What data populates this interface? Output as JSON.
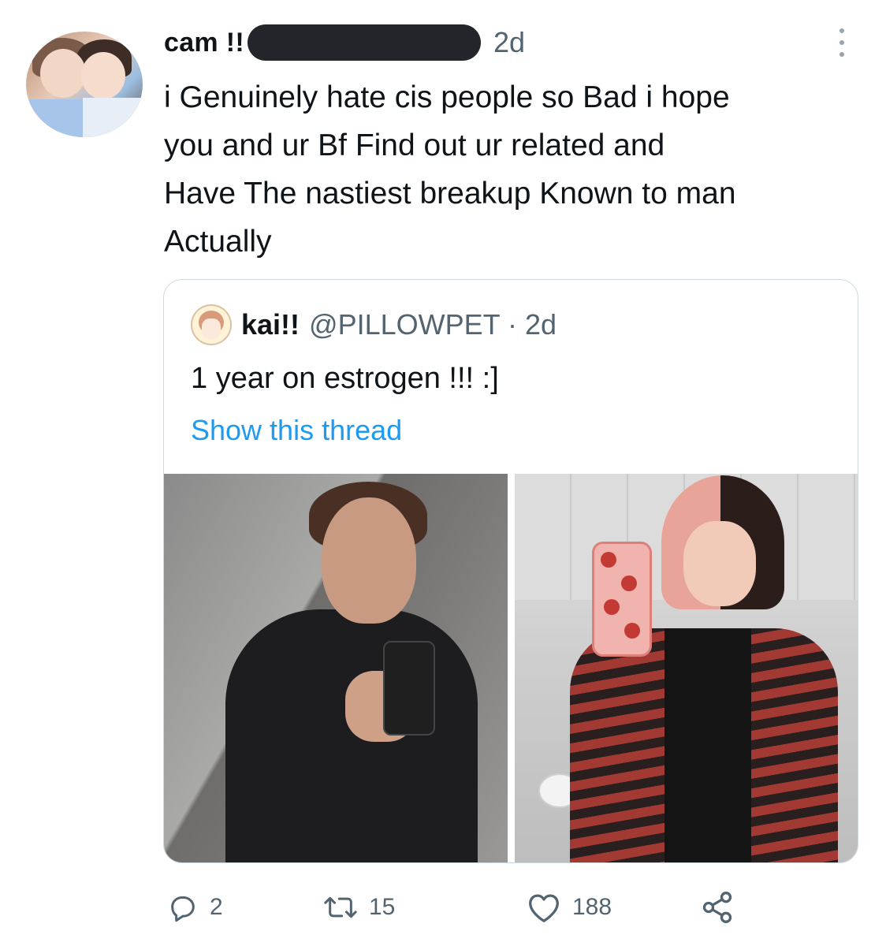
{
  "tweet": {
    "author_name": "cam !!",
    "time": "2d",
    "text": "i Genuinely hate cis people so Bad i hope\nyou and ur Bf Find out ur related and\nHave The nastiest breakup Known to man\nActually",
    "actions": {
      "replies": "2",
      "retweets": "15",
      "likes": "188"
    }
  },
  "quoted": {
    "author_name": "kai!!",
    "handle_time": "@PILLOWPET · 2d",
    "text": "1 year on estrogen !!! :]",
    "show_thread": "Show this thread"
  },
  "colors": {
    "secondary_text": "#536471",
    "link": "#1d9bf0",
    "border": "#cfd9de",
    "censor_bar": "#24252b"
  },
  "icons": [
    "more-icon",
    "reply-icon",
    "retweet-icon",
    "like-icon",
    "share-icon"
  ]
}
